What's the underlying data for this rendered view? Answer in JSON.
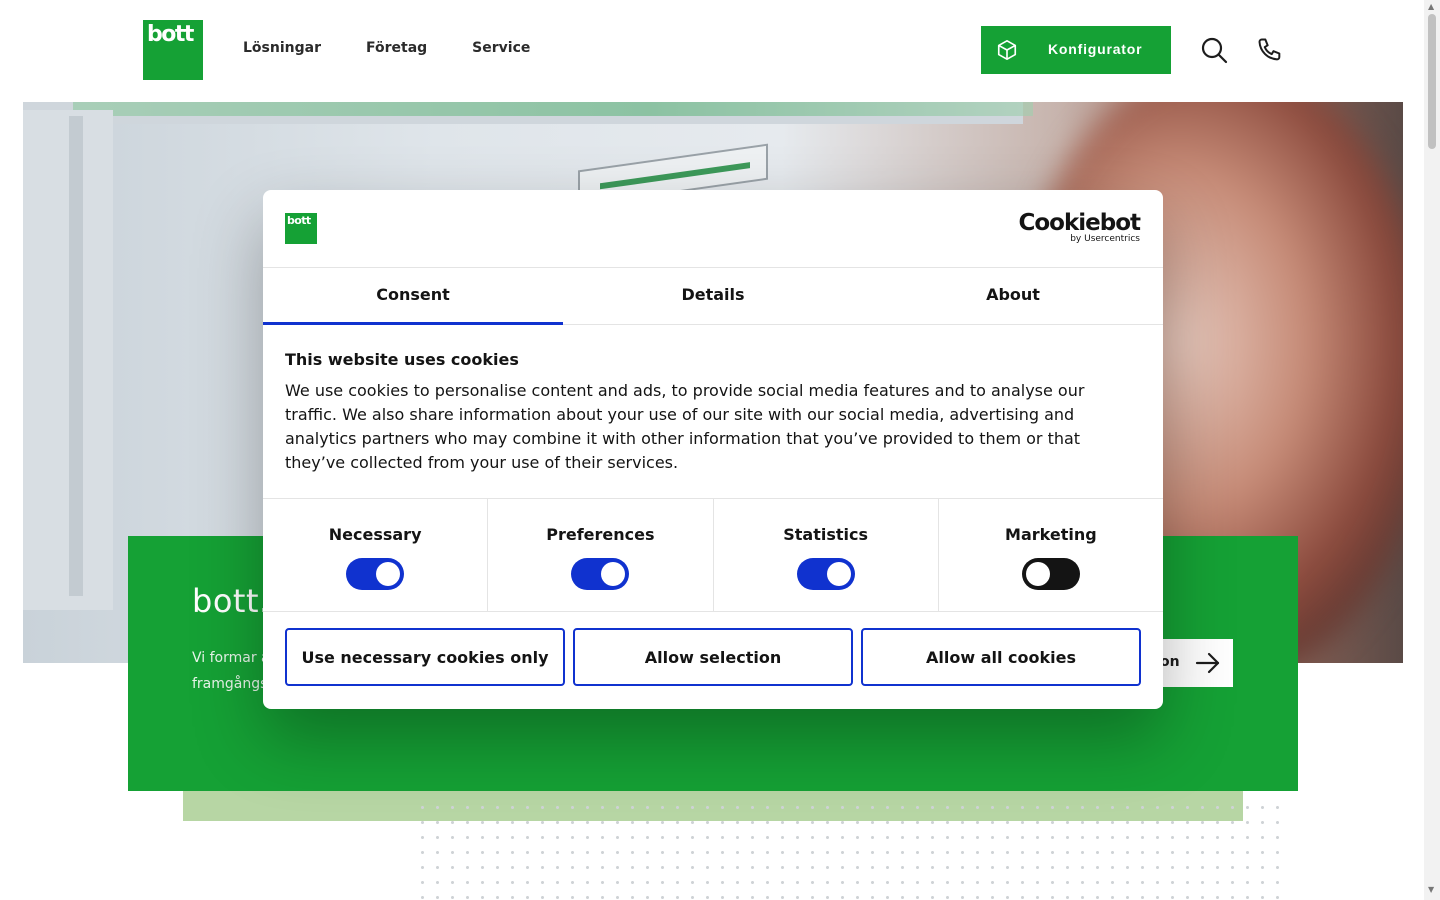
{
  "header": {
    "logo_text": "bott",
    "nav": [
      "Lösningar",
      "Företag",
      "Service"
    ],
    "configurator_label": "Konfigurator",
    "icons": [
      "cube-icon",
      "search-icon",
      "phone-icon"
    ]
  },
  "banner": {
    "title": "bott.",
    "text": "Vi formar a människor plats där utrymme och tid blir verkliga framgångsfaktorer.",
    "button_label": "on"
  },
  "cookie_dialog": {
    "logo_text": "bott",
    "brand_name": "Cookiebot",
    "brand_by": "by Usercentrics",
    "tabs": [
      "Consent",
      "Details",
      "About"
    ],
    "active_tab": "Consent",
    "heading": "This website uses cookies",
    "body": "We use cookies to personalise content and ads, to provide social media features and to analyse our traffic. We also share information about your use of our site with our social media, advertising and analytics partners who may combine it with other information that you’ve provided to them or that they’ve collected from your use of their services.",
    "categories": [
      {
        "label": "Necessary",
        "enabled": true
      },
      {
        "label": "Preferences",
        "enabled": true
      },
      {
        "label": "Statistics",
        "enabled": true
      },
      {
        "label": "Marketing",
        "enabled": false
      }
    ],
    "buttons": {
      "necessary_only": "Use necessary cookies only",
      "allow_selection": "Allow selection",
      "allow_all": "Allow all cookies"
    }
  },
  "colors": {
    "brand_green": "#15a135",
    "accent_blue": "#1032cf",
    "light_green": "#b7d6a4"
  }
}
